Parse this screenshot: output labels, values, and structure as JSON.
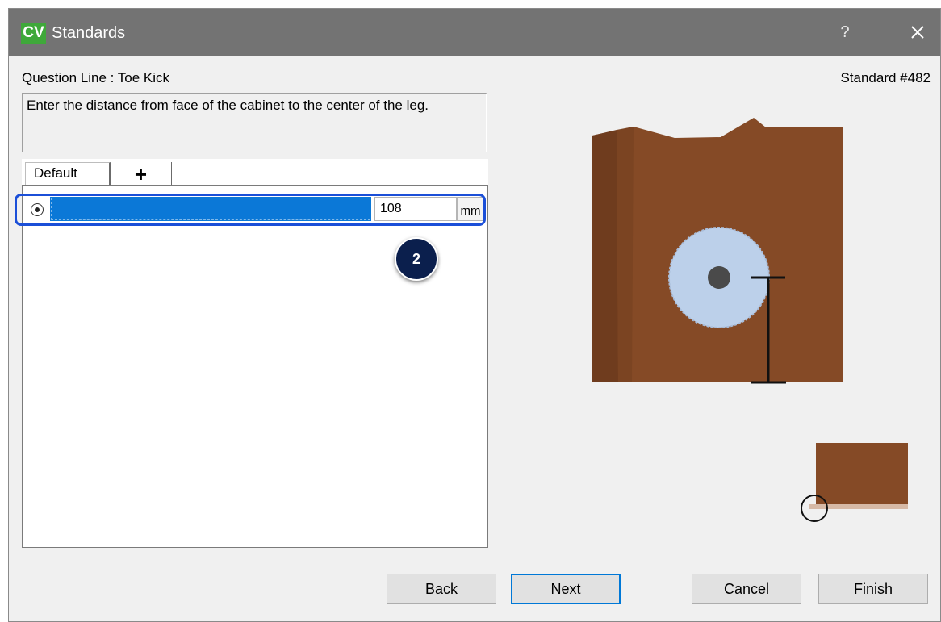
{
  "window": {
    "app_logo": "CV",
    "title": "Standards",
    "help": "?"
  },
  "question": {
    "label": "Question Line : Toe Kick",
    "standard": "Standard #482",
    "description": "Enter the distance  from face of the cabinet to the center of the leg."
  },
  "tabs": [
    {
      "label": "Default",
      "selected": true
    },
    {
      "label": "+"
    }
  ],
  "row": {
    "selected": true,
    "value": "108",
    "unit": "mm"
  },
  "callout": "2",
  "buttons": {
    "back": "Back",
    "next": "Next",
    "cancel": "Cancel",
    "finish": "Finish"
  },
  "colors": {
    "titlebar": "#737373",
    "logo": "#3fa83a",
    "highlight": "#1b4fd8",
    "selection": "#0b78d7",
    "cabinet": "#854a26",
    "cabinet_dark": "#6f3c1e",
    "leg": "#bcd0ea",
    "badge": "#0b1f4d"
  },
  "icons": [
    "close-icon",
    "radio-button-icon",
    "plus-icon"
  ]
}
